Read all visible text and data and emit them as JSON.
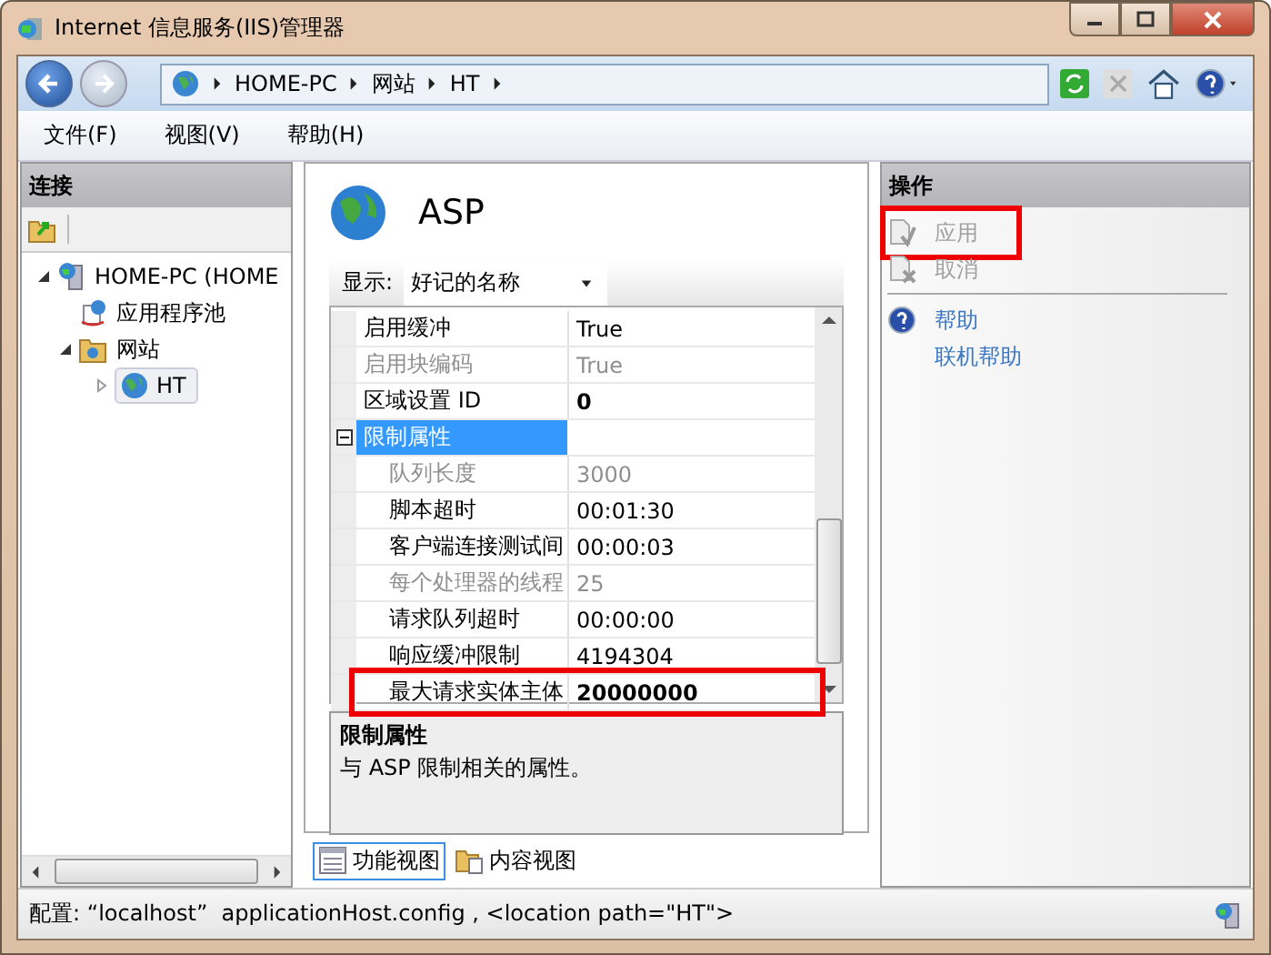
{
  "window": {
    "title": "Internet 信息服务(IIS)管理器"
  },
  "address_bar": {
    "segments": [
      "HOME-PC",
      "网站",
      "HT"
    ]
  },
  "menu": [
    "文件(F)",
    "视图(V)",
    "帮助(H)"
  ],
  "connections": {
    "title": "连接",
    "tree": [
      {
        "label": "HOME-PC (HOME",
        "kind": "server",
        "expanded": true,
        "selected": false,
        "children": [
          {
            "label": "应用程序池",
            "kind": "pool",
            "selected": false
          },
          {
            "label": "网站",
            "kind": "folder",
            "expanded": true,
            "selected": false,
            "children": [
              {
                "label": "HT",
                "kind": "site",
                "expanded": false,
                "selected": true
              }
            ]
          }
        ]
      }
    ]
  },
  "feature": {
    "title": "ASP",
    "display_label": "显示:",
    "display_value": "好记的名称",
    "properties": [
      {
        "kind": "property",
        "name": "启用缓冲",
        "value": "True",
        "disabled": false,
        "bold": false,
        "indented": false,
        "highlighted": false
      },
      {
        "kind": "property",
        "name": "启用块编码",
        "value": "True",
        "disabled": true,
        "bold": false,
        "indented": false,
        "highlighted": false
      },
      {
        "kind": "property",
        "name": "区域设置 ID",
        "value": "0",
        "disabled": false,
        "bold": true,
        "indented": false,
        "highlighted": false
      },
      {
        "kind": "category",
        "name": "限制属性",
        "expanded": true,
        "selected": true
      },
      {
        "kind": "property",
        "name": "队列长度",
        "value": "3000",
        "disabled": true,
        "bold": false,
        "indented": true,
        "highlighted": false
      },
      {
        "kind": "property",
        "name": "脚本超时",
        "value": "00:01:30",
        "disabled": false,
        "bold": false,
        "indented": true,
        "highlighted": false
      },
      {
        "kind": "property",
        "name": "客户端连接测试间",
        "value": "00:00:03",
        "disabled": false,
        "bold": false,
        "indented": true,
        "highlighted": false
      },
      {
        "kind": "property",
        "name": "每个处理器的线程",
        "value": "25",
        "disabled": true,
        "bold": false,
        "indented": true,
        "highlighted": false
      },
      {
        "kind": "property",
        "name": "请求队列超时",
        "value": "00:00:00",
        "disabled": false,
        "bold": false,
        "indented": true,
        "highlighted": false
      },
      {
        "kind": "property",
        "name": "响应缓冲限制",
        "value": "4194304",
        "disabled": false,
        "bold": false,
        "indented": true,
        "highlighted": false
      },
      {
        "kind": "property",
        "name": "最大请求实体主体",
        "value": "20000000",
        "disabled": false,
        "bold": true,
        "indented": true,
        "highlighted": true
      }
    ],
    "description": {
      "title": "限制属性",
      "text": "与 ASP 限制相关的属性。"
    },
    "view_tabs": [
      {
        "label": "功能视图",
        "kind": "features",
        "selected": true
      },
      {
        "label": "内容视图",
        "kind": "content",
        "selected": false
      }
    ]
  },
  "actions": {
    "title": "操作",
    "items": [
      {
        "label": "应用",
        "kind": "apply",
        "disabled": true,
        "highlighted": true
      },
      {
        "label": "取消",
        "kind": "cancel",
        "disabled": true,
        "highlighted": false
      },
      {
        "kind": "separator"
      },
      {
        "label": "帮助",
        "kind": "help",
        "disabled": false,
        "highlighted": false
      },
      {
        "label": "联机帮助",
        "kind": "link",
        "disabled": false,
        "highlighted": false
      }
    ]
  },
  "status_bar": {
    "text": "配置: “localhost”  applicationHost.config , <location path=\"HT\">"
  }
}
